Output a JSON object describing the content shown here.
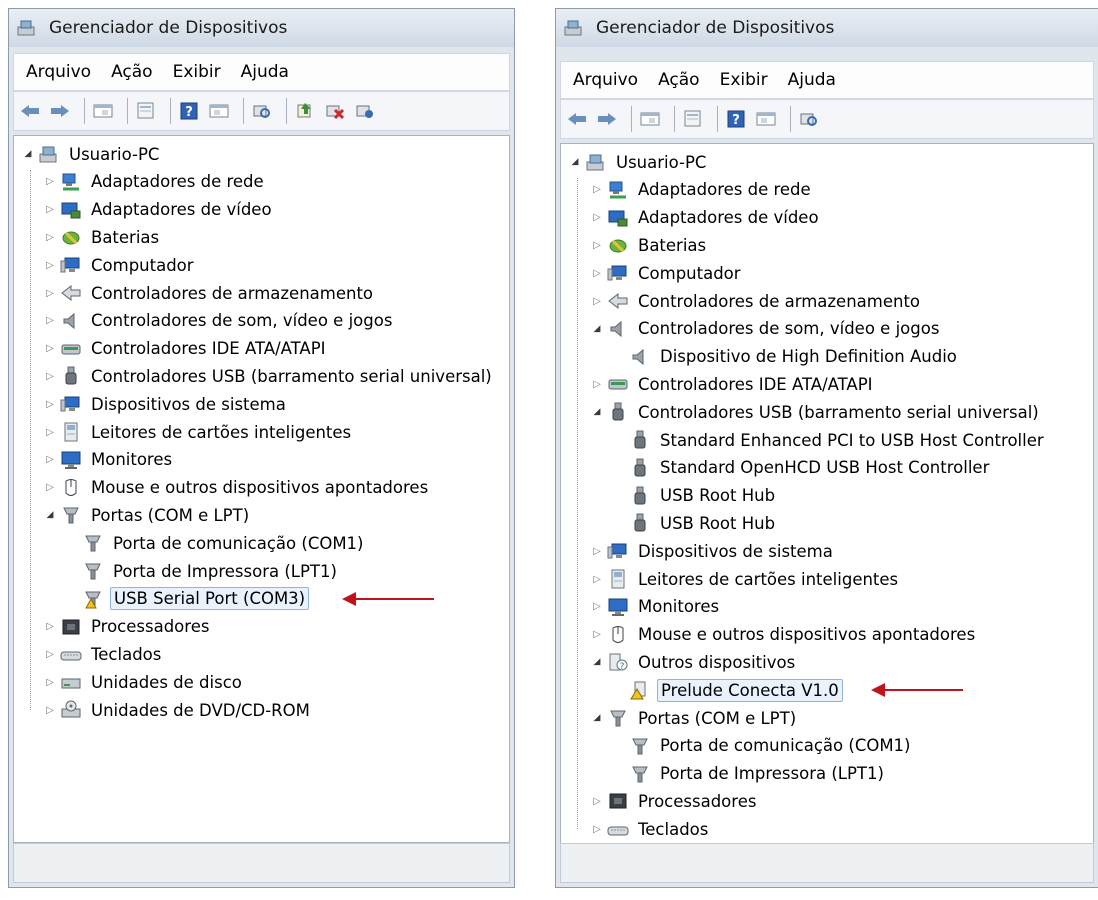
{
  "left": {
    "title": "Gerenciador de Dispositivos",
    "menu": [
      "Arquivo",
      "Ação",
      "Exibir",
      "Ajuda"
    ],
    "root": "Usuario-PC",
    "items": [
      {
        "label": "Adaptadores de rede",
        "icon": "network-adapter-icon"
      },
      {
        "label": "Adaptadores de vídeo",
        "icon": "display-adapter-icon"
      },
      {
        "label": "Baterias",
        "icon": "battery-icon"
      },
      {
        "label": "Computador",
        "icon": "computer-icon"
      },
      {
        "label": "Controladores de armazenamento",
        "icon": "storage-controller-icon"
      },
      {
        "label": "Controladores de som, vídeo e jogos",
        "icon": "speaker-icon"
      },
      {
        "label": "Controladores IDE ATA/ATAPI",
        "icon": "ide-controller-icon"
      },
      {
        "label": "Controladores USB (barramento serial universal)",
        "icon": "usb-icon"
      },
      {
        "label": "Dispositivos de sistema",
        "icon": "system-device-icon"
      },
      {
        "label": "Leitores de cartões inteligentes",
        "icon": "smart-card-reader-icon"
      },
      {
        "label": "Monitores",
        "icon": "monitor-icon"
      },
      {
        "label": "Mouse e outros dispositivos apontadores",
        "icon": "mouse-icon"
      },
      {
        "label": "Portas (COM e LPT)",
        "icon": "port-icon"
      },
      {
        "label": "Porta de comunicação (COM1)",
        "icon": "port-icon"
      },
      {
        "label": "Porta de Impressora (LPT1)",
        "icon": "port-icon"
      },
      {
        "label": "USB Serial Port (COM3)",
        "icon": "port-warning-icon"
      },
      {
        "label": "Processadores",
        "icon": "processor-icon"
      },
      {
        "label": "Teclados",
        "icon": "keyboard-icon"
      },
      {
        "label": "Unidades de disco",
        "icon": "disk-drive-icon"
      },
      {
        "label": "Unidades de DVD/CD-ROM",
        "icon": "dvd-drive-icon"
      }
    ]
  },
  "right": {
    "title": "Gerenciador de Dispositivos",
    "menu": [
      "Arquivo",
      "Ação",
      "Exibir",
      "Ajuda"
    ],
    "root": "Usuario-PC",
    "items": [
      {
        "label": "Adaptadores de rede",
        "icon": "network-adapter-icon"
      },
      {
        "label": "Adaptadores de vídeo",
        "icon": "display-adapter-icon"
      },
      {
        "label": "Baterias",
        "icon": "battery-icon"
      },
      {
        "label": "Computador",
        "icon": "computer-icon"
      },
      {
        "label": "Controladores de armazenamento",
        "icon": "storage-controller-icon"
      },
      {
        "label": "Controladores de som, vídeo e jogos",
        "icon": "speaker-icon"
      },
      {
        "label": "Dispositivo de High Definition Audio",
        "icon": "speaker-icon"
      },
      {
        "label": "Controladores IDE ATA/ATAPI",
        "icon": "ide-controller-icon"
      },
      {
        "label": "Controladores USB (barramento serial universal)",
        "icon": "usb-icon"
      },
      {
        "label": "Standard Enhanced PCI to USB Host Controller",
        "icon": "usb-icon"
      },
      {
        "label": "Standard OpenHCD USB Host Controller",
        "icon": "usb-icon"
      },
      {
        "label": "USB Root Hub",
        "icon": "usb-icon"
      },
      {
        "label": "USB Root Hub",
        "icon": "usb-icon"
      },
      {
        "label": "Dispositivos de sistema",
        "icon": "system-device-icon"
      },
      {
        "label": "Leitores de cartões inteligentes",
        "icon": "smart-card-reader-icon"
      },
      {
        "label": "Monitores",
        "icon": "monitor-icon"
      },
      {
        "label": "Mouse e outros dispositivos apontadores",
        "icon": "mouse-icon"
      },
      {
        "label": "Outros dispositivos",
        "icon": "unknown-device-icon"
      },
      {
        "label": "Prelude Conecta V1.0",
        "icon": "unknown-device-warning-icon"
      },
      {
        "label": "Portas (COM e LPT)",
        "icon": "port-icon"
      },
      {
        "label": "Porta de comunicação (COM1)",
        "icon": "port-icon"
      },
      {
        "label": "Porta de Impressora (LPT1)",
        "icon": "port-icon"
      },
      {
        "label": "Processadores",
        "icon": "processor-icon"
      },
      {
        "label": "Teclados",
        "icon": "keyboard-icon"
      }
    ]
  },
  "colors": {
    "arrow": "#c0141c",
    "selection_border": "#8fb4dc",
    "selection_fill": "#eaf3fd"
  }
}
